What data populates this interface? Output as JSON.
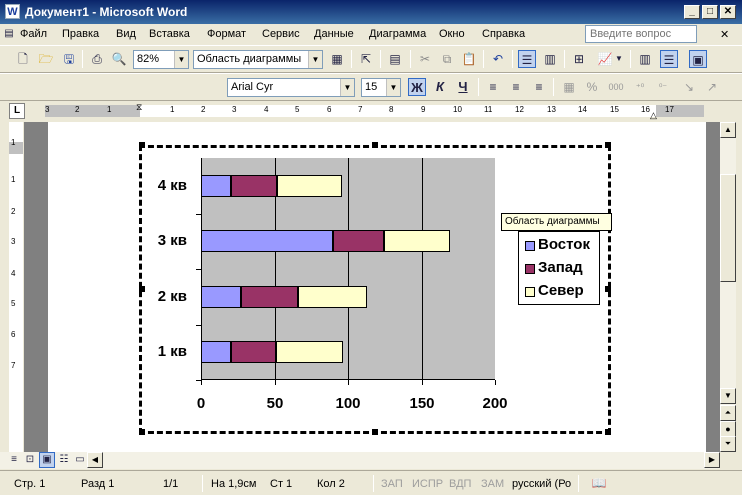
{
  "window": {
    "title": "Документ1 - Microsoft Word",
    "app_icon": "W"
  },
  "menu": {
    "items": [
      "Файл",
      "Правка",
      "Вид",
      "Вставка",
      "Формат",
      "Сервис",
      "Данные",
      "Диаграмма",
      "Окно",
      "Справка"
    ],
    "ask_placeholder": "Введите вопрос"
  },
  "toolbar": {
    "zoom": "82%",
    "object_selector": "Область диаграммы",
    "font_name": "Arial Cyr",
    "font_size": "15",
    "bold_label": "Ж",
    "italic_label": "К",
    "underline_label": "Ч",
    "percent_label": "%",
    "thousands_label": "000"
  },
  "ruler": {
    "labels": [
      "3",
      "2",
      "1",
      "1",
      "2",
      "3",
      "4",
      "5",
      "6",
      "7",
      "8",
      "9",
      "10",
      "11",
      "12",
      "13",
      "14",
      "15",
      "16",
      "17"
    ],
    "vertical_labels": [
      "1",
      "1",
      "2",
      "3",
      "4",
      "5",
      "6",
      "7"
    ]
  },
  "chart_data": {
    "type": "bar",
    "orientation": "horizontal",
    "stacked": true,
    "categories": [
      "1 кв",
      "2 кв",
      "3 кв",
      "4 кв"
    ],
    "series": [
      {
        "name": "Восток",
        "values": [
          20.4,
          27.4,
          90,
          20.4
        ],
        "color": "#9999ff"
      },
      {
        "name": "Запад",
        "values": [
          30.6,
          38.6,
          34.6,
          31.6
        ],
        "color": "#993366"
      },
      {
        "name": "Север",
        "values": [
          45.9,
          46.9,
          45,
          43.9
        ],
        "color": "#ffffcc"
      }
    ],
    "xlim": [
      0,
      200
    ],
    "xticks": [
      "0",
      "50",
      "100",
      "150",
      "200"
    ],
    "grid": true,
    "plot_background": "#c0c0c0",
    "legend_position": "right"
  },
  "tooltip": "Область диаграммы",
  "status": {
    "page": "Стр. 1",
    "section": "Разд 1",
    "pages": "1/1",
    "at": "На 1,9см",
    "line": "Ст 1",
    "col": "Кол 2",
    "rec": "ЗАП",
    "trk": "ИСПР",
    "ext": "ВДП",
    "ovr": "ЗАМ",
    "language": "русский (Ро"
  }
}
